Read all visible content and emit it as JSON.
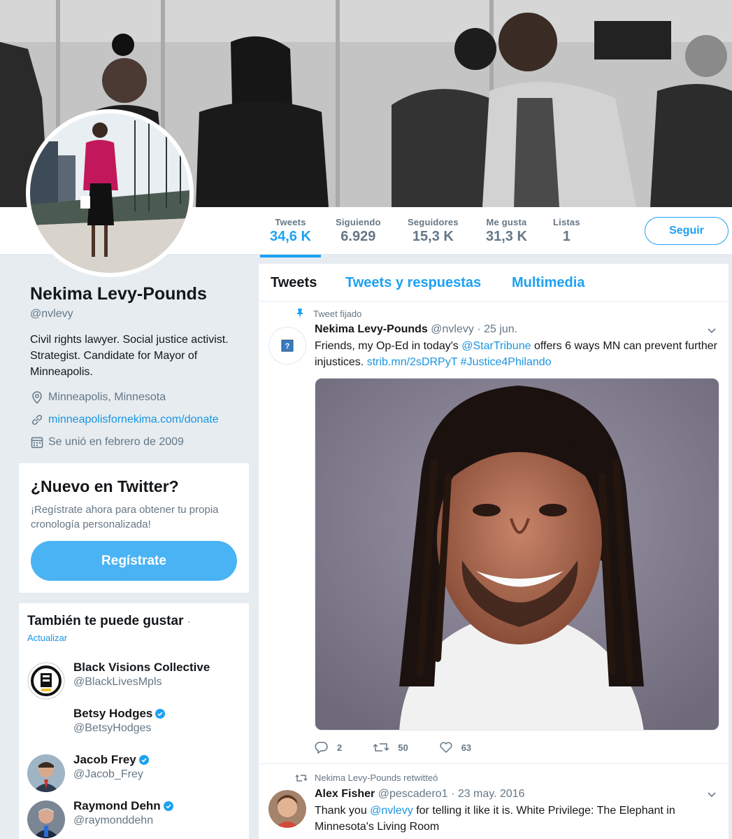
{
  "profile": {
    "name": "Nekima Levy-Pounds",
    "handle": "@nvlevy",
    "bio": "Civil rights lawyer. Social justice activist. Strategist. Candidate for Mayor of Minneapolis.",
    "location": "Minneapolis, Minnesota",
    "website": "minneapolisfornekima.com/donate",
    "joined": "Se unió en febrero de 2009"
  },
  "stats": [
    {
      "label": "Tweets",
      "value": "34,6 K"
    },
    {
      "label": "Siguiendo",
      "value": "6.929"
    },
    {
      "label": "Seguidores",
      "value": "15,3 K"
    },
    {
      "label": "Me gusta",
      "value": "31,3 K"
    },
    {
      "label": "Listas",
      "value": "1"
    }
  ],
  "follow_label": "Seguir",
  "signup": {
    "title": "¿Nuevo en Twitter?",
    "text": "¡Regístrate ahora para obtener tu propia cronología personalizada!",
    "button": "Regístrate"
  },
  "suggestions": {
    "title": "También te puede gustar",
    "dot": "·",
    "refresh": "Actualizar",
    "items": [
      {
        "name": "Black Visions Collective",
        "handle": "@BlackLivesMpls",
        "verified": false
      },
      {
        "name": "Betsy Hodges",
        "handle": "@BetsyHodges",
        "verified": true
      },
      {
        "name": "Jacob Frey",
        "handle": "@Jacob_Frey",
        "verified": true
      },
      {
        "name": "Raymond Dehn",
        "handle": "@raymonddehn",
        "verified": true
      }
    ]
  },
  "tabs": [
    "Tweets",
    "Tweets y respuestas",
    "Multimedia"
  ],
  "pinned_tweet": {
    "context": "Tweet fijado",
    "name": "Nekima Levy-Pounds",
    "handle": "@nvlevy",
    "sep": "·",
    "date": "25 jun.",
    "text_1": "Friends, my Op-Ed in today's ",
    "mention": "@StarTribune",
    "text_2": " offers 6 ways MN can prevent further injustices. ",
    "link": "strib.mn/2sDRPyT",
    "hashtag": "#Justice4Philando",
    "replies": "2",
    "retweets": "50",
    "likes": "63"
  },
  "retweet": {
    "context": "Nekima Levy-Pounds retwitteó",
    "name": "Alex Fisher",
    "handle": "@pescadero1",
    "sep": "·",
    "date": "23 may. 2016",
    "text_1": "Thank you ",
    "mention": "@nvlevy",
    "text_2": " for telling it like it is. White Privilege: The Elephant in Minnesota's Living Room"
  },
  "colors": {
    "accent": "#1da1f2",
    "link": "#1b95e0",
    "muted": "#657786",
    "page_bg": "#e6ecf0"
  }
}
